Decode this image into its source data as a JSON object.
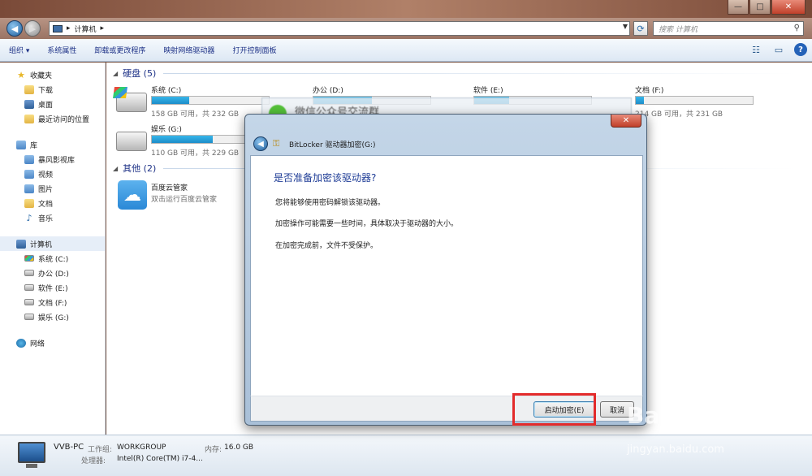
{
  "window": {
    "minimize_glyph": "—",
    "maximize_glyph": "□",
    "close_glyph": "✕"
  },
  "address_bar": {
    "path": [
      "计算机"
    ],
    "search_placeholder": "搜索 计算机"
  },
  "toolbar": {
    "items": [
      "组织 ▾",
      "系统属性",
      "卸载或更改程序",
      "映射网络驱动器",
      "打开控制面板"
    ]
  },
  "nav": {
    "favorites": {
      "label": "收藏夹",
      "items": [
        "下载",
        "桌面",
        "最近访问的位置"
      ]
    },
    "libraries": {
      "label": "库",
      "items": [
        "暴风影视库",
        "视频",
        "图片",
        "文档",
        "音乐"
      ]
    },
    "computer": {
      "label": "计算机",
      "items": [
        "系统 (C:)",
        "办公 (D:)",
        "软件 (E:)",
        "文档 (F:)",
        "娱乐 (G:)"
      ]
    },
    "network": {
      "label": "网络"
    }
  },
  "content": {
    "hard_disks_header": "硬盘 (5)",
    "drives": [
      {
        "name": "系统 (C:)",
        "info": "158 GB 可用，共 232 GB",
        "used_fraction": 0.32
      },
      {
        "name": "办公 (D:)",
        "info": "",
        "used_fraction": 0.5
      },
      {
        "name": "软件 (E:)",
        "info": "",
        "used_fraction": 0.3
      },
      {
        "name": "文档 (F:)",
        "info": "214 GB 可用，共 231 GB",
        "used_fraction": 0.07
      },
      {
        "name": "娱乐 (G:)",
        "info": "110 GB 可用，共 229 GB",
        "used_fraction": 0.52
      }
    ],
    "other_header": "其他 (2)",
    "app": {
      "name": "百度云管家",
      "desc": "双击运行百度云管家"
    }
  },
  "background_window": {
    "title": "微信公众号交流群"
  },
  "details": {
    "pc_name": "VVB-PC",
    "workgroup_label": "工作组:",
    "workgroup": "WORKGROUP",
    "memory_label": "内存:",
    "memory": "16.0 GB",
    "cpu_label": "处理器:",
    "cpu": "Intel(R) Core(TM) i7-4..."
  },
  "dialog": {
    "title": "BitLocker 驱动器加密(G:)",
    "heading": "是否准备加密该驱动器?",
    "paragraphs": [
      "您将能够使用密码解锁该驱动器。",
      "加密操作可能需要一些时间，具体取决于驱动器的大小。",
      "在加密完成前，文件不受保护。"
    ],
    "start_button": "启动加密(E)",
    "cancel_button": "取消"
  },
  "watermark": {
    "brand": "Bai du 经验",
    "url": "jingyan.baidu.com"
  },
  "colors": {
    "accent": "#1e3287",
    "highlight": "#e32b2b",
    "bar": "#26a0da"
  }
}
